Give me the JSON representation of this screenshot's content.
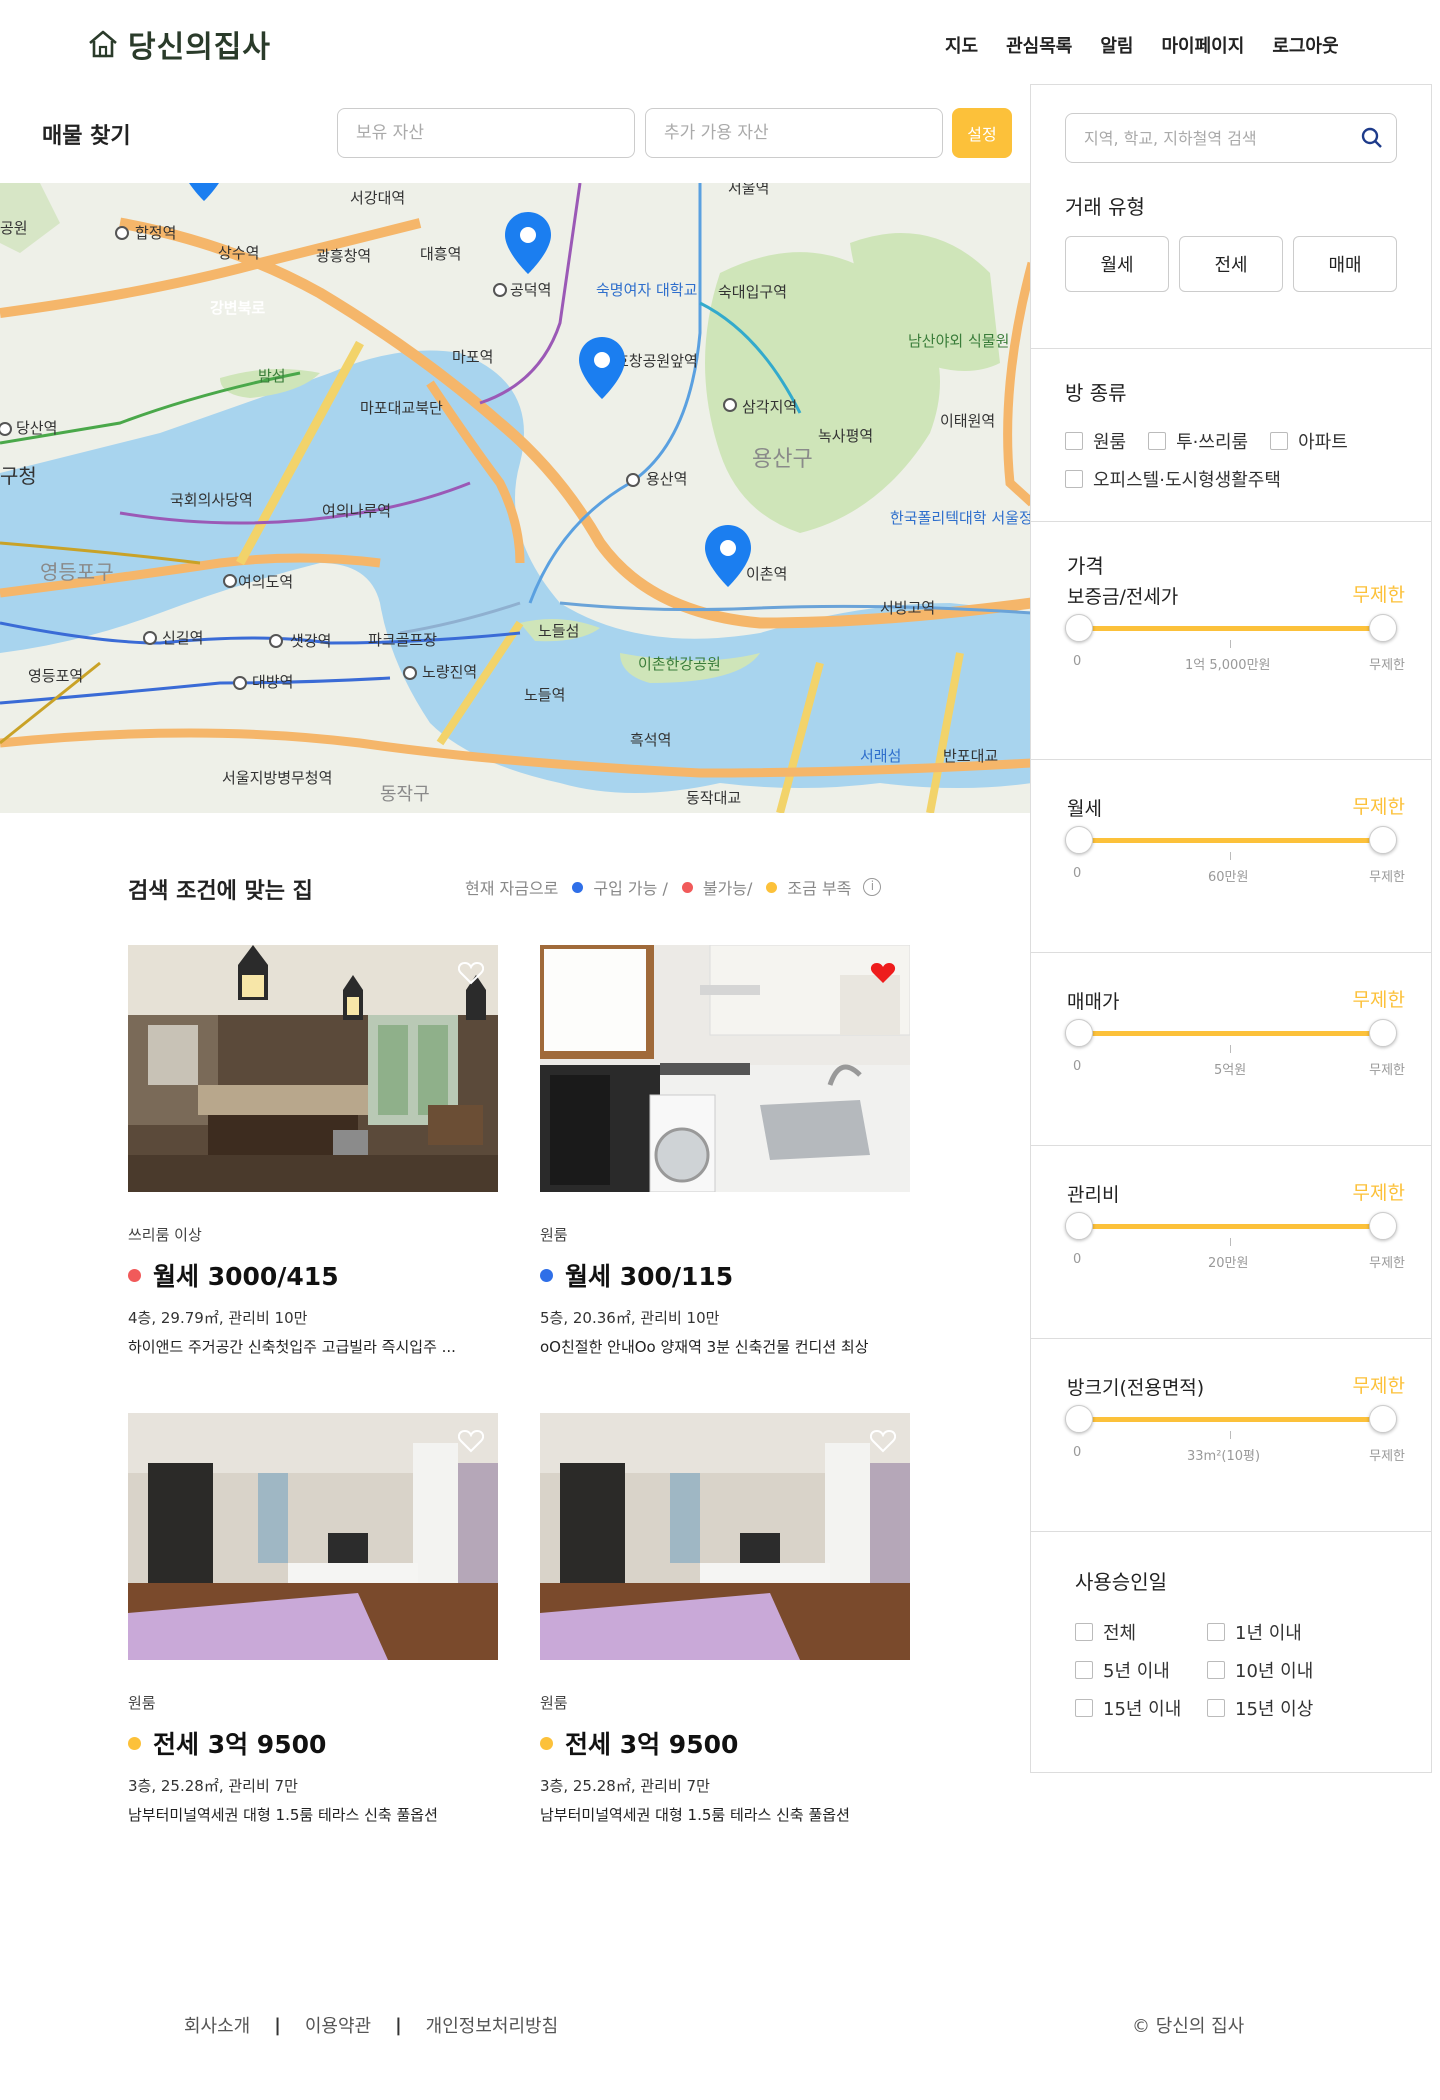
{
  "header": {
    "logo": "당신의집사",
    "nav": [
      "지도",
      "관심목록",
      "알림",
      "마이페이지",
      "로그아웃"
    ]
  },
  "search_bar": {
    "title": "매물 찾기",
    "own_asset_placeholder": "보유 자산",
    "extra_asset_placeholder": "추가 가용 자산",
    "set_button": "설정"
  },
  "map": {
    "labels": {
      "hapjeong": "합정역",
      "sangsu": "상수역",
      "gwangheungchang": "광흥창역",
      "daeheung": "대흥역",
      "seogang": "서강대역",
      "gongdeok": "공덕역",
      "mapo": "마포역",
      "sookmyung": "숙명여자 대학교",
      "sookdae": "숙대입구역",
      "hyochang": "효창공원앞역",
      "samgakji": "삼각지역",
      "namsan": "남산야외 식물원",
      "noksapyeong": "녹사평역",
      "itaewon": "이태원역",
      "yongsan_gu": "용산구",
      "yongsan": "용산역",
      "ichon": "이촌역",
      "seobinggo": "서빙고역",
      "polytech": "한국폴리텍대학 서울정수캠퍼스",
      "gukhoe": "국회의사당역",
      "yeouinaru": "여의나루역",
      "yeouido": "여의도역",
      "dangsan": "당산역",
      "yeongdeungpo_gu": "영등포구",
      "singil": "신길역",
      "saetgang": "샛강역",
      "daebang": "대방역",
      "nodeul_island": "노들섬",
      "nodeul": "노들역",
      "ichon_park": "이촌한강공원",
      "noryangjin": "노량진역",
      "heukseok": "흑석역",
      "seoraeseom": "서래섬",
      "banpo": "반포대교",
      "dongjak_bridge": "동작대교",
      "seoul_station": "서울역",
      "gangbyeon": "강변북로",
      "mapo_bridge": "마포대교북단",
      "yeongdeungpo": "영등포역",
      "gongwon_top": "공원",
      "seoul_military": "서울지방병무청역",
      "bamseom": "밤섬",
      "park_golf": "파크골프장",
      "gu_office": "구청",
      "dongjak_gu": "동작구"
    }
  },
  "results": {
    "title": "검색 조건에 맞는 집",
    "legend_prefix": "현재 자금으로",
    "legend_items": [
      {
        "label": "구입 가능 /",
        "color": "#2f6fe8"
      },
      {
        "label": "불가능/",
        "color": "#f15a5a"
      },
      {
        "label": "조금 부족",
        "color": "#fcc13a"
      }
    ],
    "info_icon": "i",
    "cards": [
      {
        "kind": "쓰리룸 이상",
        "status_color": "#f15a5a",
        "price": "월세 3000/415",
        "spec": "4층, 29.79㎡, 관리비 10만",
        "desc": "하이앤드 주거공간 신축첫입주 고급빌라 즉시입주 ...",
        "liked": false,
        "photo": "kitchen-photo"
      },
      {
        "kind": "원룸",
        "status_color": "#2f6fe8",
        "price": "월세 300/115",
        "spec": "5층, 20.36㎡, 관리비 10만",
        "desc": "oO친절한 안내Oo 양재역 3분 신축건물 컨디션 최상",
        "liked": true,
        "photo": "sink-photo"
      },
      {
        "kind": "원룸",
        "status_color": "#fcc13a",
        "price": "전세 3억 9500",
        "spec": "3층, 25.28㎡, 관리비 7만",
        "desc": "남부터미널역세권 대형 1.5룸 테라스 신축 풀옵션",
        "liked": false,
        "photo": "bedroom-photo"
      },
      {
        "kind": "원룸",
        "status_color": "#fcc13a",
        "price": "전세 3억 9500",
        "spec": "3층, 25.28㎡, 관리비 7만",
        "desc": "남부터미널역세권 대형 1.5룸 테라스 신축 풀옵션",
        "liked": false,
        "photo": "bedroom-photo"
      }
    ]
  },
  "sidebar": {
    "search_placeholder": "지역, 학교, 지하철역 검색",
    "deal_type_label": "거래 유형",
    "deal_types": [
      "월세",
      "전세",
      "매매"
    ],
    "room_type_label": "방 종류",
    "room_types": [
      "원룸",
      "투·쓰리룸",
      "아파트",
      "오피스텔·도시형생활주택"
    ],
    "price_label": "가격",
    "ranges": [
      {
        "title": "보증금/전세가",
        "unlimited": "무제한",
        "min": "0",
        "mid": "1억 5,000만원",
        "max": "무제한"
      },
      {
        "title": "월세",
        "unlimited": "무제한",
        "min": "0",
        "mid": "60만원",
        "max": "무제한"
      },
      {
        "title": "매매가",
        "unlimited": "무제한",
        "min": "0",
        "mid": "5억원",
        "max": "무제한"
      },
      {
        "title": "관리비",
        "unlimited": "무제한",
        "min": "0",
        "mid": "20만원",
        "max": "무제한"
      },
      {
        "title": "방크기(전용면적)",
        "unlimited": "무제한",
        "min": "0",
        "mid": "33m²(10평)",
        "max": "무제한"
      }
    ],
    "approval_label": "사용승인일",
    "approval_options": [
      "전체",
      "1년 이내",
      "5년 이내",
      "10년 이내",
      "15년 이내",
      "15년 이상"
    ]
  },
  "footer": {
    "links": [
      "회사소개",
      "이용약관",
      "개인정보처리방침"
    ],
    "copyright": "© 당신의 집사"
  },
  "colors": {
    "accent": "#fcc13a",
    "pin": "#1b7ef0",
    "river": "#a8d4ee",
    "park": "#cfe5b9"
  }
}
